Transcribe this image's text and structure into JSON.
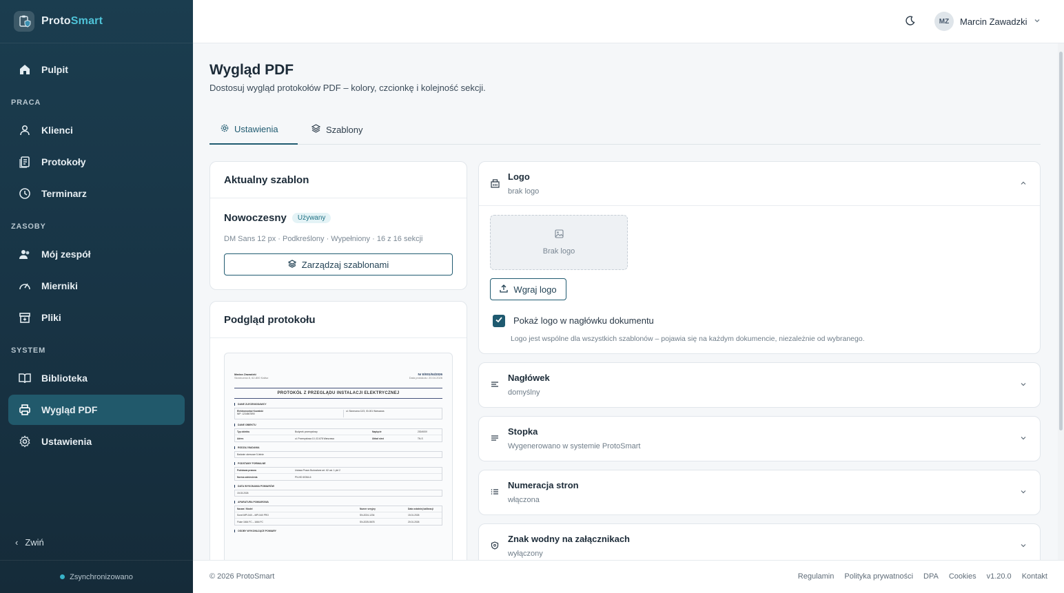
{
  "brand": {
    "name_part1": "Proto",
    "name_part2": "Smart"
  },
  "sidebar": {
    "top_item": {
      "label": "Pulpit",
      "icon": "home-icon"
    },
    "sections": [
      {
        "title": "PRACA",
        "items": [
          {
            "label": "Klienci",
            "icon": "user-icon"
          },
          {
            "label": "Protokoły",
            "icon": "document-icon"
          },
          {
            "label": "Terminarz",
            "icon": "clock-icon"
          }
        ]
      },
      {
        "title": "ZASOBY",
        "items": [
          {
            "label": "Mój zespół",
            "icon": "team-icon"
          },
          {
            "label": "Mierniki",
            "icon": "gauge-icon"
          },
          {
            "label": "Pliki",
            "icon": "archive-icon"
          }
        ]
      },
      {
        "title": "SYSTEM",
        "items": [
          {
            "label": "Biblioteka",
            "icon": "book-icon"
          },
          {
            "label": "Wygląd PDF",
            "icon": "printer-icon",
            "active": true
          },
          {
            "label": "Ustawienia",
            "icon": "gear-icon"
          }
        ]
      }
    ],
    "collapse_label": "Zwiń",
    "sync_status": "Zsynchronizowano"
  },
  "topbar": {
    "user_initials": "MZ",
    "user_name": "Marcin Zawadzki"
  },
  "page": {
    "title": "Wygląd PDF",
    "subtitle": "Dostosuj wygląd protokołów PDF – kolory, czcionkę i kolejność sekcji."
  },
  "tabs": [
    {
      "label": "Ustawienia",
      "icon": "gear-icon",
      "active": true
    },
    {
      "label": "Szablony",
      "icon": "layers-icon"
    }
  ],
  "current_template": {
    "heading": "Aktualny szablon",
    "name": "Nowoczesny",
    "badge": "Używany",
    "meta": "DM Sans 12 px · Podkreślony · Wypełniony · 16 z 16 sekcji",
    "manage_button": "Zarządzaj szablonami"
  },
  "preview": {
    "heading": "Podgląd protokołu",
    "doc": {
      "author": "Marian Zawadzki",
      "address": "Słonecznia 8, 62-800 Kalisz",
      "number": "Nr E/001/04/2026",
      "date_line": "Data protokołu: 20.04.2026",
      "title": "PROTOKÓŁ Z PRZEGLĄDU INSTALACJI ELEKTRYCZNEJ",
      "sec_client": "DANE ZLECENIODAWCY",
      "client_name": "Elektromontaż Kowalski",
      "client_nip": "NIP: 1234567890",
      "client_addr": "ul. Słoneczna 12/3, 00-001 Warszawa",
      "sec_object": "DANE OBIEKTU",
      "obj_type_label": "Typ obiektu",
      "obj_type": "Budynek przemysłowy",
      "obj_voltage_label": "Napięcie",
      "obj_voltage": "230/400V",
      "obj_addr_label": "Adres",
      "obj_addr": "ul. Przemysłowa 10, 02-678 Warszawa",
      "obj_system_label": "Układ sieci",
      "obj_system": "TN-S",
      "sec_type": "RODZAJ BADANIA",
      "type_value": "Badanie okresowe 5-letnie",
      "sec_formal": "PODSTAWY FORMALNE",
      "legal_label": "Podstawa prawna",
      "legal_value": "Ustawa Prawo Budowlane art. 62 ust. 1 pkt 2",
      "norm_label": "Norma odniesienia",
      "norm_value": "PN-HD 60364-6",
      "sec_date": "DATA WYKONANIA POMIARÓW",
      "date_value": "15.03.2026",
      "sec_equipment": "APARATURA POMIAROWA",
      "eq_col1": "Nazwa / Model",
      "eq_col2": "Numer seryjny",
      "eq_col3": "Data ostatniej kalibracji",
      "eq1_name": "Sonel MPI-540 – MPI-540 PRO",
      "eq1_sn": "SN-2024-1234",
      "eq1_date": "15.01.2026",
      "eq2_name": "Fluke 1664 FC – 1664 FC",
      "eq2_sn": "SN-2025-5678",
      "eq2_date": "20.01.2026",
      "sec_persons": "OSOBY WYKONUJĄCE POMIARY"
    }
  },
  "logo_section": {
    "title": "Logo",
    "subtitle": "brak logo",
    "placeholder": "Brak logo",
    "upload_button": "Wgraj logo",
    "checkbox_label": "Pokaż logo w nagłówku dokumentu",
    "checkbox_checked": true,
    "note": "Logo jest wspólne dla wszystkich szablonów – pojawia się na każdym dokumencie, niezależnie od wybranego."
  },
  "accordions": [
    {
      "title": "Nagłówek",
      "subtitle": "domyślny",
      "icon": "align-left-icon"
    },
    {
      "title": "Stopka",
      "subtitle": "Wygenerowano w systemie ProtoSmart",
      "icon": "align-left-icon"
    },
    {
      "title": "Numeracja stron",
      "subtitle": "włączona",
      "icon": "list-numbered-icon"
    },
    {
      "title": "Znak wodny na załącznikach",
      "subtitle": "wyłączony",
      "icon": "shield-icon"
    }
  ],
  "footer": {
    "copyright": "© 2026 ProtoSmart",
    "links": [
      "Regulamin",
      "Polityka prywatności",
      "DPA",
      "Cookies",
      "v1.20.0",
      "Kontakt"
    ]
  },
  "colors": {
    "sidebar_bg": "#1b3d4f",
    "accent": "#1f5a70",
    "brand_accent": "#4fc3d8",
    "active_item": "#21596b"
  }
}
